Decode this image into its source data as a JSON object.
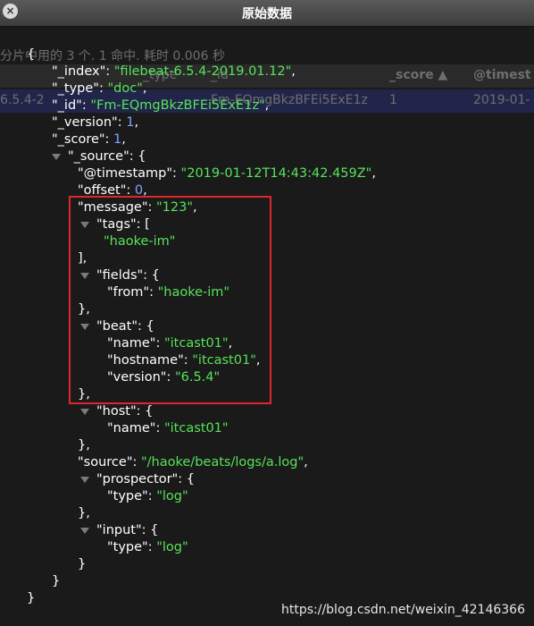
{
  "window": {
    "title": "原始数据",
    "close_label": "×"
  },
  "background": {
    "query_info": "分片中用的 3 个. 1 命中. 耗时 0.006 秒",
    "col_type": "_type",
    "col_id": "_id",
    "col_score": "_score ▲",
    "col_timestamp": "@timest",
    "row_index": "6.5.4-2",
    "row_id": "Fm-EQmgBkzBFEi5ExE1z",
    "row_score": "1",
    "row_timestamp": "2019-01-"
  },
  "json": {
    "open_brace": "{",
    "index_key": "\"_index\": ",
    "index_val": "\"filebeat-6.5.4-2019.01.12\"",
    "type_key": "\"_type\": ",
    "type_val": "\"doc\"",
    "id_key": "\"_id\": ",
    "id_val": "\"Fm-EQmgBkzBFEi5ExE1z\"",
    "version_key": "\"_version\": ",
    "version_val": "1",
    "score_key": "\"_score\": ",
    "score_val": "1",
    "source_key": "\"_source\": {",
    "timestamp_key": "\"@timestamp\": ",
    "timestamp_val": "\"2019-01-12T14:43:42.459Z\"",
    "offset_key": "\"offset\": ",
    "offset_val": "0",
    "message_key": "\"message\": ",
    "message_val": "\"123\"",
    "tags_key": "\"tags\": [",
    "tags_val": "\"haoke-im\"",
    "tags_close": "],",
    "fields_key": "\"fields\": {",
    "from_key": "\"from\": ",
    "from_val": "\"haoke-im\"",
    "fields_close": "},",
    "beat_key": "\"beat\": {",
    "name_key": "\"name\": ",
    "name_val": "\"itcast01\"",
    "hostname_key": "\"hostname\": ",
    "hostname_val": "\"itcast01\"",
    "bversion_key": "\"version\": ",
    "bversion_val": "\"6.5.4\"",
    "beat_close": "},",
    "host_key": "\"host\": {",
    "host_name_key": "\"name\": ",
    "host_name_val": "\"itcast01\"",
    "host_close": "},",
    "src_key": "\"source\": ",
    "src_val": "\"/haoke/beats/logs/a.log\"",
    "prospector_key": "\"prospector\": {",
    "ptype_key": "\"type\": ",
    "ptype_val": "\"log\"",
    "prospector_close": "},",
    "input_key": "\"input\": {",
    "itype_key": "\"type\": ",
    "itype_val": "\"log\"",
    "input_close": "}",
    "source_close": "}",
    "close_brace": "}",
    "comma": ","
  },
  "watermark": "https://blog.csdn.net/weixin_42146366"
}
